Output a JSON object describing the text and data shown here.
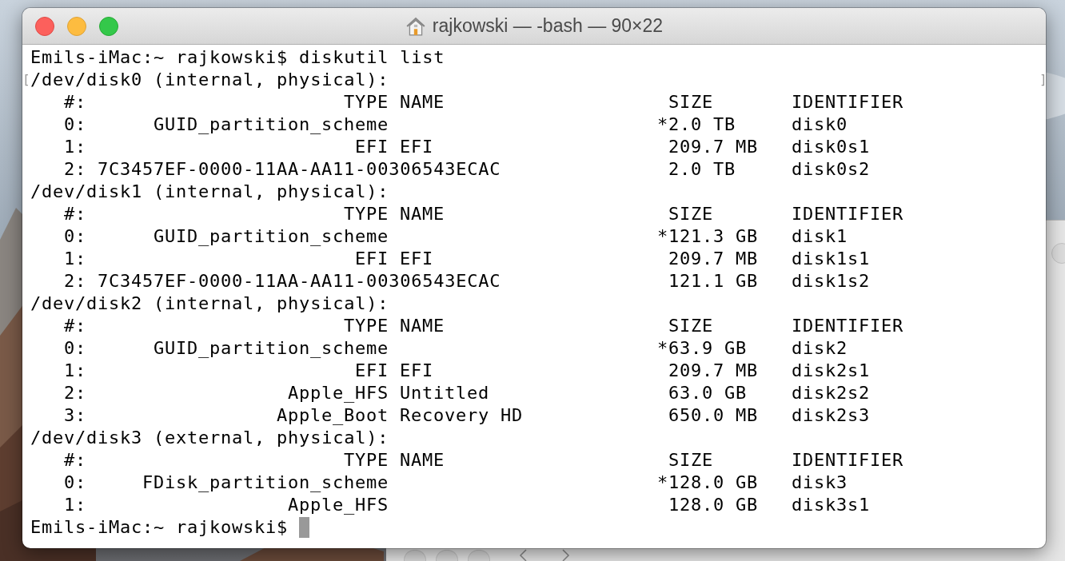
{
  "window": {
    "title": "rajkowski — -bash — 90×22"
  },
  "terminal": {
    "command_line": "Emils-iMac:~ rajkowski$ diskutil list",
    "marker_left": "[",
    "marker_right": "]",
    "disks": [
      {
        "header": "/dev/disk0 (internal, physical):",
        "columns": {
          "number": "#:",
          "type": "TYPE",
          "name": "NAME",
          "size": "SIZE",
          "identifier": "IDENTIFIER"
        },
        "partitions": [
          {
            "number": "0:",
            "type": "GUID_partition_scheme",
            "star": "*",
            "size": "2.0 TB",
            "identifier": "disk0"
          },
          {
            "number": "1:",
            "type": "EFI",
            "name": "EFI",
            "size": "209.7 MB",
            "identifier": "disk0s1"
          },
          {
            "number": "2:",
            "type": "7C3457EF-0000-11AA-AA11-00306543ECAC",
            "size": "2.0 TB",
            "identifier": "disk0s2"
          }
        ]
      },
      {
        "header": "/dev/disk1 (internal, physical):",
        "columns": {
          "number": "#:",
          "type": "TYPE",
          "name": "NAME",
          "size": "SIZE",
          "identifier": "IDENTIFIER"
        },
        "partitions": [
          {
            "number": "0:",
            "type": "GUID_partition_scheme",
            "star": "*",
            "size": "121.3 GB",
            "identifier": "disk1"
          },
          {
            "number": "1:",
            "type": "EFI",
            "name": "EFI",
            "size": "209.7 MB",
            "identifier": "disk1s1"
          },
          {
            "number": "2:",
            "type": "7C3457EF-0000-11AA-AA11-00306543ECAC",
            "size": "121.1 GB",
            "identifier": "disk1s2"
          }
        ]
      },
      {
        "header": "/dev/disk2 (internal, physical):",
        "columns": {
          "number": "#:",
          "type": "TYPE",
          "name": "NAME",
          "size": "SIZE",
          "identifier": "IDENTIFIER"
        },
        "partitions": [
          {
            "number": "0:",
            "type": "GUID_partition_scheme",
            "star": "*",
            "size": "63.9 GB",
            "identifier": "disk2"
          },
          {
            "number": "1:",
            "type": "EFI",
            "name": "EFI",
            "size": "209.7 MB",
            "identifier": "disk2s1"
          },
          {
            "number": "2:",
            "type": "Apple_HFS",
            "name": "Untitled",
            "size": "63.0 GB",
            "identifier": "disk2s2"
          },
          {
            "number": "3:",
            "type": "Apple_Boot",
            "name": "Recovery HD",
            "size": "650.0 MB",
            "identifier": "disk2s3"
          }
        ]
      },
      {
        "header": "/dev/disk3 (external, physical):",
        "columns": {
          "number": "#:",
          "type": "TYPE",
          "name": "NAME",
          "size": "SIZE",
          "identifier": "IDENTIFIER"
        },
        "partitions": [
          {
            "number": "0:",
            "type": "FDisk_partition_scheme",
            "star": "*",
            "size": "128.0 GB",
            "identifier": "disk3"
          },
          {
            "number": "1:",
            "type": "Apple_HFS",
            "size": "128.0 GB",
            "identifier": "disk3s1"
          }
        ]
      }
    ],
    "prompt": "Emils-iMac:~ rajkowski$"
  }
}
